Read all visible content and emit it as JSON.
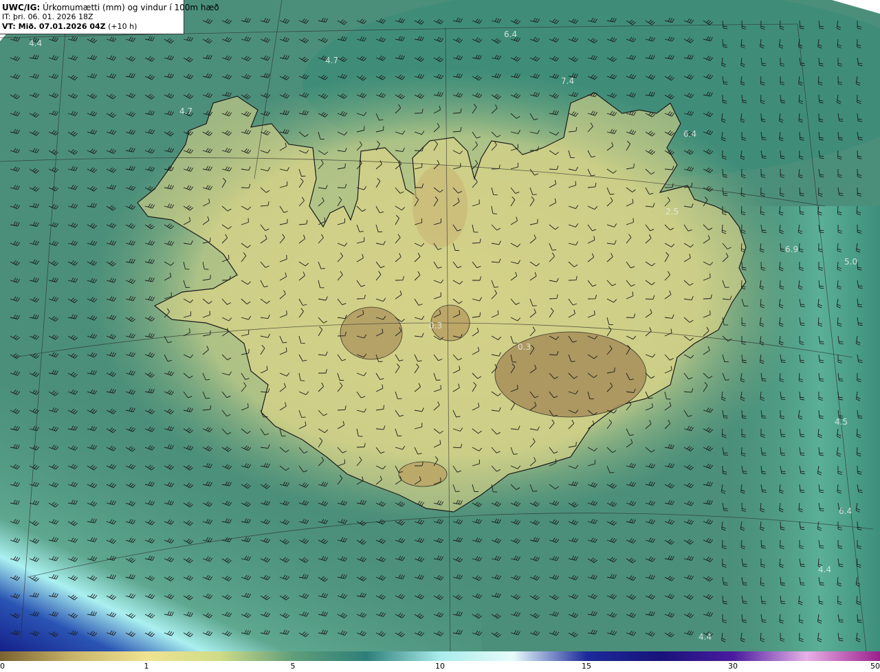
{
  "header": {
    "model_prefix": "UWC/IG:",
    "title": " Úrkomumætti (mm) og vindur í 100m hæð",
    "it_line": "IT: þri. 06. 01. 2026 18Z",
    "vt_prefix": "VT: Mið. 07.01.2026 04Z",
    "vt_suffix": " (+10 h)"
  },
  "map_labels": [
    "4.4",
    "4.7",
    "6.4",
    "4.7",
    "7.4",
    "6.4",
    "2.5",
    "6.9",
    "5.0",
    "0.3",
    "0.3",
    "4.5",
    "4.4",
    "4.4",
    "6.4"
  ],
  "colorbar": {
    "ticks": [
      "0",
      "1",
      "5",
      "10",
      "15",
      "30",
      "50"
    ],
    "tick_values": [
      0,
      1,
      5,
      10,
      15,
      30,
      50
    ],
    "colors": [
      "#7a6330",
      "#c9b56a",
      "#efe391",
      "#cfdc88",
      "#5f9e7a",
      "#2e7f7a",
      "#a9ecec",
      "#e8fbfb",
      "#1c2a9a",
      "#18137a",
      "#4a1aa0",
      "#e8b0e6",
      "#9b1f8c"
    ]
  },
  "colors": {
    "ocean": "#3f8a77",
    "land": "#e6d98a",
    "highland": "#a8905c",
    "heavy": "#1f2f9a"
  }
}
